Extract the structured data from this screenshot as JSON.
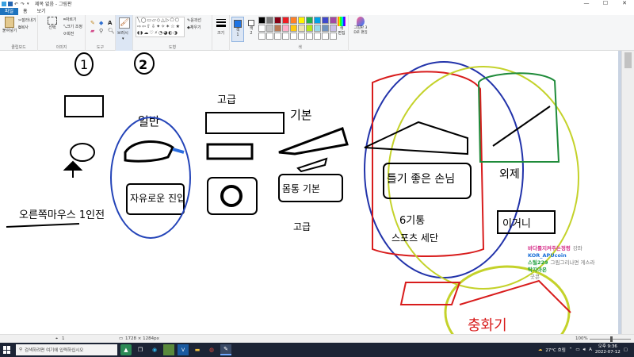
{
  "window": {
    "title": "제목 없음 - 그림판",
    "minimize": "—",
    "maximize": "☐",
    "close": "✕"
  },
  "tabs": [
    {
      "label": "파일"
    },
    {
      "label": "홈"
    },
    {
      "label": "보기"
    }
  ],
  "ribbon": {
    "clipboard": {
      "paste": "붙여넣기",
      "cut": "잘라내기",
      "copy": "복사",
      "label": "클립보드"
    },
    "image": {
      "select": "선택",
      "crop": "자르기",
      "resize": "크기 조정",
      "rotate": "회전",
      "label": "이미지"
    },
    "tools": {
      "label": "도구"
    },
    "brushes": {
      "label": "브러시"
    },
    "shapes": {
      "outline": "윤곽선",
      "fill": "채우기",
      "label": "도형"
    },
    "size": {
      "label": "크기"
    },
    "color1": {
      "label": "색\n1"
    },
    "color2": {
      "label": "색\n2"
    },
    "colors": {
      "edit": "색\n편집",
      "edit3d": "그림판 3\nD로 편집",
      "label": "색"
    }
  },
  "palette": [
    "#000000",
    "#7f7f7f",
    "#880015",
    "#ed1c24",
    "#ff7f27",
    "#fff200",
    "#22b14c",
    "#00a2e8",
    "#3f48cc",
    "#a349a4",
    "#ffffff",
    "#c3c3c3",
    "#b97a57",
    "#ffaec9",
    "#ffc90e",
    "#efe4b0",
    "#b5e61d",
    "#99d9ea",
    "#7092be",
    "#c8bfe7",
    "#ffffff",
    "#ffffff",
    "#ffffff",
    "#ffffff",
    "#ffffff",
    "#ffffff",
    "#ffffff",
    "#ffffff",
    "#ffffff",
    "#ffffff"
  ],
  "canvas_drawing": {
    "num1": "1",
    "num2": "2",
    "label_normal": "일반",
    "label_advanced": "고급",
    "label_basic": "기본",
    "box_normal": "자유로운 진입",
    "box_basic": "몸통 기본",
    "left_text": "오른쪽마우스 1인전",
    "outer_label": "외제",
    "outer_box": "이거니",
    "big_text": "충화기",
    "center_big_text": "틀기 좋은 손님",
    "left_word": "고급",
    "number_label": "6기통",
    "kr_text": "스포츠 세단"
  },
  "chat": [
    {
      "user": "바다를지켜주는정령",
      "msg": "강좌",
      "cls": "u1"
    },
    {
      "user": "KOR_APUcoin",
      "msg": "",
      "cls": "u2"
    },
    {
      "user": "스틸229",
      "msg": "그림그리나면 게스라",
      "cls": "u3"
    },
    {
      "user": "탁지아온",
      "msg": "",
      "cls": "u3"
    },
    {
      "user": "",
      "msg": "굿콘",
      "cls": "msg"
    }
  ],
  "status": {
    "pos": "1",
    "size": "1728 × 1284px",
    "zoom": "100%"
  },
  "taskbar": {
    "search_placeholder": "검색하려면 여기에 입력하십시오",
    "weather": "27°C 흐림",
    "time": "오후 9:36",
    "date": "2022-07-12"
  }
}
